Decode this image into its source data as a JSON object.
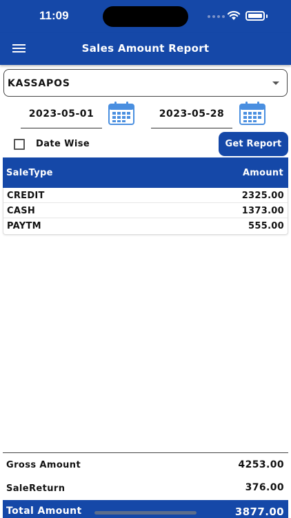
{
  "status_bar": {
    "time": "11:09"
  },
  "app_bar": {
    "title": "Sales Amount Report"
  },
  "store_select": {
    "value": "KASSAPOS"
  },
  "filters": {
    "from_date": "2023-05-01",
    "to_date": "2023-05-28",
    "date_wise_label": "Date Wise",
    "date_wise_checked": false,
    "get_report_label": "Get Report"
  },
  "table": {
    "headers": {
      "type": "SaleType",
      "amount": "Amount"
    },
    "rows": [
      {
        "type": "CREDIT",
        "amount": "2325.00"
      },
      {
        "type": "CASH",
        "amount": "1373.00"
      },
      {
        "type": "PAYTM",
        "amount": "555.00"
      }
    ]
  },
  "summary": {
    "gross_label": "Gross Amount",
    "gross_value": "4253.00",
    "return_label": "SaleReturn",
    "return_value": "376.00",
    "total_label": "Total Amount",
    "total_value": "3877.00"
  },
  "colors": {
    "primary": "#1548a8",
    "calendar": "#4a8fe0"
  },
  "icons": {
    "menu": "hamburger-menu-icon",
    "calendar": "calendar-icon",
    "dropdown": "dropdown-caret-icon"
  }
}
